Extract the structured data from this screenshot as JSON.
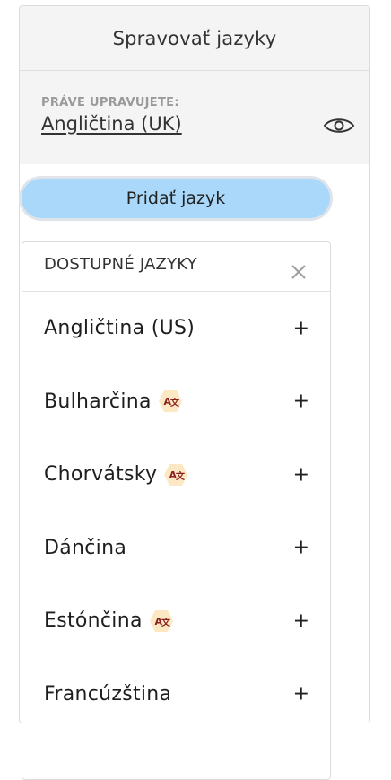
{
  "header": {
    "title": "Spravovať jazyky"
  },
  "editing": {
    "label": "PRÁVE UPRAVUJETE:",
    "language": "Angličtina (UK)",
    "visibility_icon": "eye-icon"
  },
  "add_button": {
    "label": "Pridať jazyk"
  },
  "available": {
    "title": "DOSTUPNÉ JAZYKY",
    "close_icon": "close-icon",
    "languages": [
      {
        "label": "Angličtina (US)",
        "translate_badge": false
      },
      {
        "label": "Bulharčina",
        "translate_badge": true
      },
      {
        "label": "Chorvátsky",
        "translate_badge": true
      },
      {
        "label": "Dánčina",
        "translate_badge": false
      },
      {
        "label": "Estónčina",
        "translate_badge": true
      },
      {
        "label": "Francúzština",
        "translate_badge": false
      }
    ],
    "add_symbol": "+"
  },
  "colors": {
    "header_bg": "#f4f4f4",
    "button_bg": "#a9d8fb",
    "badge_bg": "#fde8c4",
    "badge_fg": "#8a1f1f"
  }
}
